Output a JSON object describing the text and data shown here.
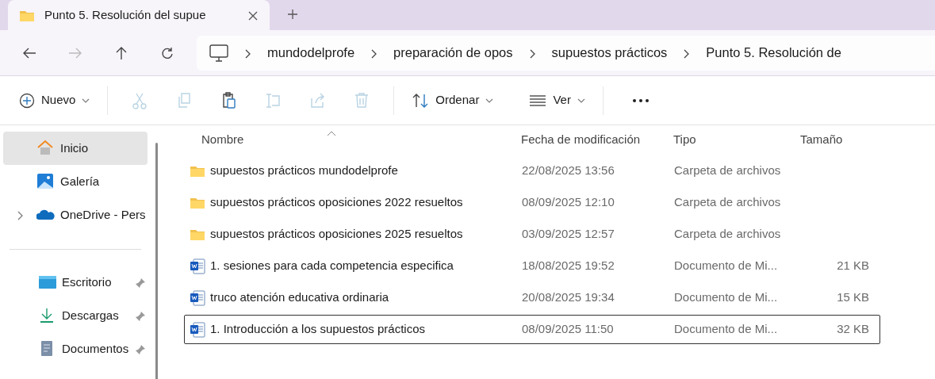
{
  "tab": {
    "title": "Punto 5. Resolución del supue",
    "selected": true
  },
  "navigation": [
    {
      "kind": "back",
      "disabled": false
    },
    {
      "kind": "forward",
      "disabled": true
    },
    {
      "kind": "up",
      "disabled": false
    },
    {
      "kind": "refresh",
      "disabled": false
    }
  ],
  "breadcrumb": [
    "mundodelprofe",
    "preparación de opos",
    "supuestos prácticos",
    "Punto 5. Resolución de"
  ],
  "toolbar": [
    {
      "kind": "new",
      "label": "Nuevo"
    },
    {
      "kind": "cut",
      "disabled": true
    },
    {
      "kind": "copy",
      "disabled": true
    },
    {
      "kind": "paste",
      "disabled": false
    },
    {
      "kind": "rename",
      "disabled": true
    },
    {
      "kind": "share",
      "disabled": true
    },
    {
      "kind": "delete",
      "disabled": true
    },
    {
      "kind": "sort",
      "label": "Ordenar"
    },
    {
      "kind": "view",
      "label": "Ver"
    },
    {
      "kind": "more"
    }
  ],
  "sidebar": {
    "items": [
      {
        "kind": "home",
        "label": "Inicio",
        "selected": true,
        "pinned": false
      },
      {
        "kind": "gallery",
        "label": "Galería",
        "selected": false,
        "pinned": false
      },
      {
        "kind": "cloud",
        "label": "OneDrive - Pers",
        "selected": false,
        "pinned": false,
        "expanded": false
      },
      {
        "kind": "divider"
      },
      {
        "kind": "desktop",
        "label": "Escritorio",
        "selected": false,
        "pinned": true
      },
      {
        "kind": "downloads",
        "label": "Descargas",
        "selected": false,
        "pinned": true
      },
      {
        "kind": "documents",
        "label": "Documentos",
        "selected": false,
        "pinned": true
      }
    ]
  },
  "table": {
    "columns": [
      "Nombre",
      "Fecha de modificación",
      "Tipo",
      "Tamaño"
    ],
    "rows": [
      {
        "kind": "folder",
        "name": "supuestos prácticos mundodelprofe",
        "modified": "22/08/2025 13:56",
        "type": "Carpeta de archivos",
        "focused": false
      },
      {
        "kind": "folder",
        "name": "supuestos prácticos oposiciones 2022 resueltos",
        "modified": "08/09/2025 12:10",
        "type": "Carpeta de archivos",
        "focused": false
      },
      {
        "kind": "folder",
        "name": "supuestos prácticos oposiciones 2025 resueltos",
        "modified": "03/09/2025 12:57",
        "type": "Carpeta de archivos",
        "focused": false
      },
      {
        "kind": "word",
        "name": "1. sesiones para cada competencia especifica",
        "modified": "18/08/2025 19:52",
        "type": "Documento de Mi...",
        "size": "21 KB",
        "focused": false
      },
      {
        "kind": "word",
        "name": "truco atención educativa ordinaria",
        "modified": "20/08/2025 19:34",
        "type": "Documento de Mi...",
        "size": "15 KB",
        "focused": false
      },
      {
        "kind": "word",
        "name": "1. Introducción a los supuestos prácticos",
        "modified": "08/09/2025 11:50",
        "type": "Documento de Mi...",
        "size": "32 KB",
        "focused": true
      }
    ]
  }
}
